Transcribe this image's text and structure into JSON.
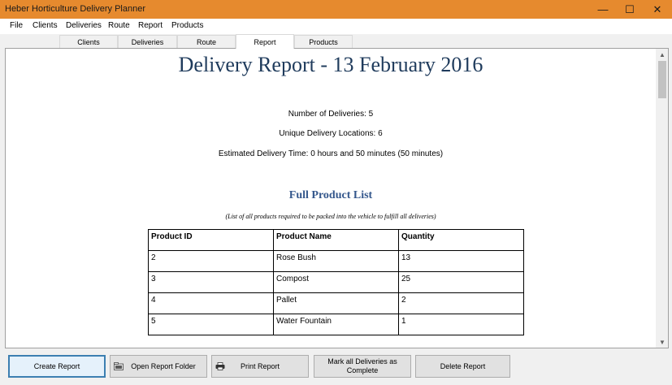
{
  "window": {
    "title": "Heber Horticulture Delivery Planner",
    "accent_color": "#e68a2e",
    "controls": {
      "minimize": "—",
      "maximize": "☐",
      "close": "✕"
    }
  },
  "menu": [
    "File",
    "Clients",
    "Deliveries",
    "Route",
    "Report",
    "Products"
  ],
  "tabs": [
    {
      "label": "Clients",
      "active": false
    },
    {
      "label": "Deliveries",
      "active": false
    },
    {
      "label": "Route",
      "active": false
    },
    {
      "label": "Report",
      "active": true
    },
    {
      "label": "Products",
      "active": false
    }
  ],
  "report": {
    "title": "Delivery Report - 13 February 2016",
    "stats": {
      "deliveries": "Number of Deliveries: 5",
      "locations": "Unique Delivery Locations: 6",
      "time": "Estimated Delivery Time: 0 hours and 50 minutes (50 minutes)"
    },
    "product_list_title": "Full Product List",
    "product_list_note": "(List of all products required to be packed into the vehicle to fulfill all deliveries)",
    "table": {
      "headers": [
        "Product ID",
        "Product Name",
        "Quantity"
      ],
      "rows": [
        [
          "2",
          "Rose Bush",
          "13"
        ],
        [
          "3",
          "Compost",
          "25"
        ],
        [
          "4",
          "Pallet",
          "2"
        ],
        [
          "5",
          "Water Fountain",
          "1"
        ]
      ]
    }
  },
  "buttons": {
    "create": "Create Report",
    "open_folder": "Open Report Folder",
    "print": "Print Report",
    "mark_complete_line1": "Mark all Deliveries as",
    "mark_complete_line2": "Complete",
    "delete": "Delete Report"
  },
  "icons": {
    "folder": "folder-icon",
    "printer": "printer-icon",
    "scroll_up": "▲",
    "scroll_down": "▼"
  }
}
